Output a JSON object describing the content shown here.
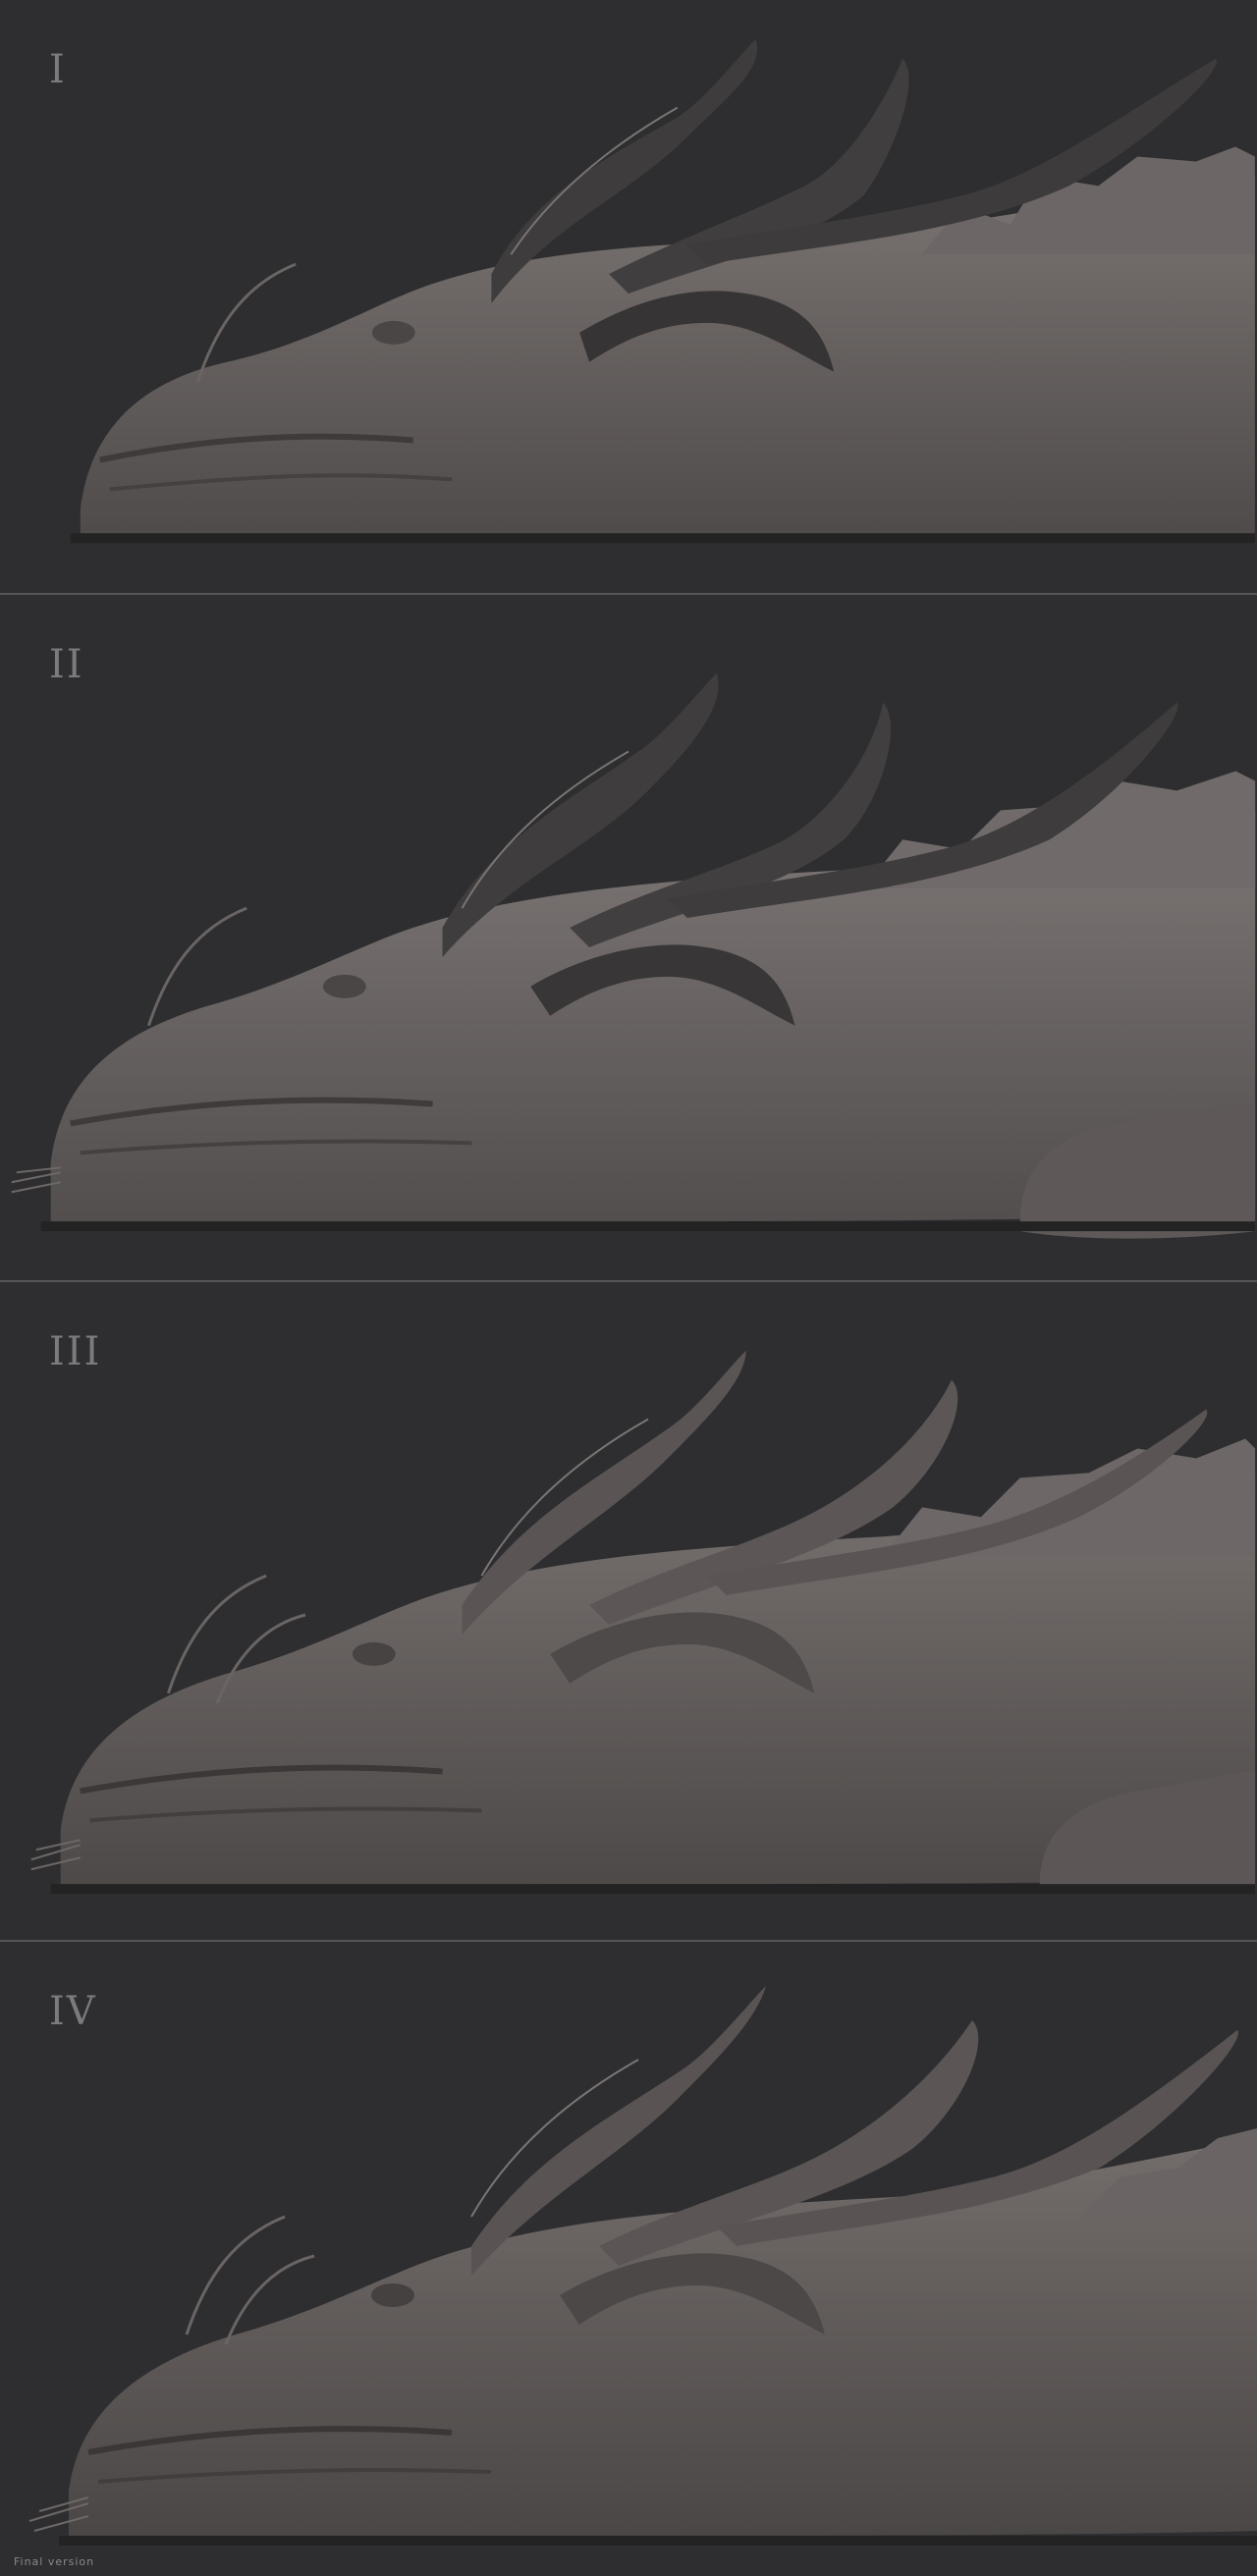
{
  "panels": [
    {
      "label": "I"
    },
    {
      "label": "II"
    },
    {
      "label": "III"
    },
    {
      "label": "IV"
    }
  ],
  "caption": "Final version",
  "colors": {
    "background": "#2e2e30",
    "separator": "#555558",
    "clay": "#6f6a68",
    "clay_dark": "#3e3c3c",
    "label": "#7b7b7e"
  }
}
